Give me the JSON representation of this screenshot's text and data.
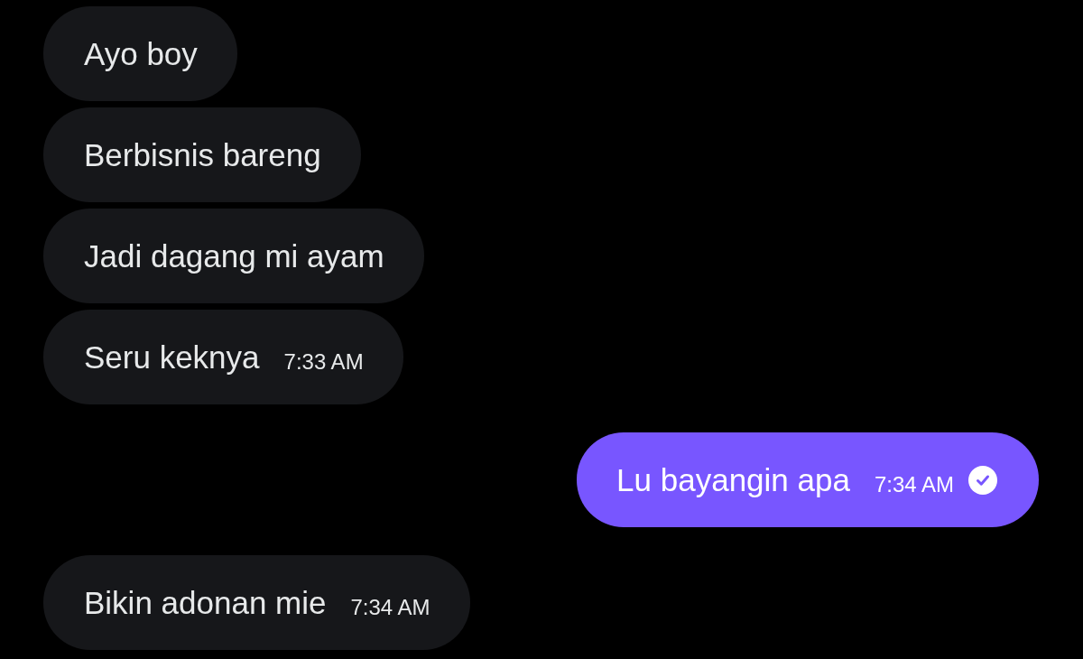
{
  "groups": [
    {
      "kind": "incoming",
      "messages": [
        {
          "text": "Ayo boy"
        },
        {
          "text": "Berbisnis bareng"
        },
        {
          "text": "Jadi dagang mi ayam"
        },
        {
          "text": "Seru keknya",
          "time": "7:33 AM"
        }
      ]
    },
    {
      "kind": "outgoing",
      "messages": [
        {
          "text": "Lu bayangin apa",
          "time": "7:34 AM",
          "sent": true
        }
      ]
    },
    {
      "kind": "incoming",
      "messages": [
        {
          "text": "Bikin adonan mie",
          "time": "7:34 AM"
        }
      ]
    }
  ]
}
